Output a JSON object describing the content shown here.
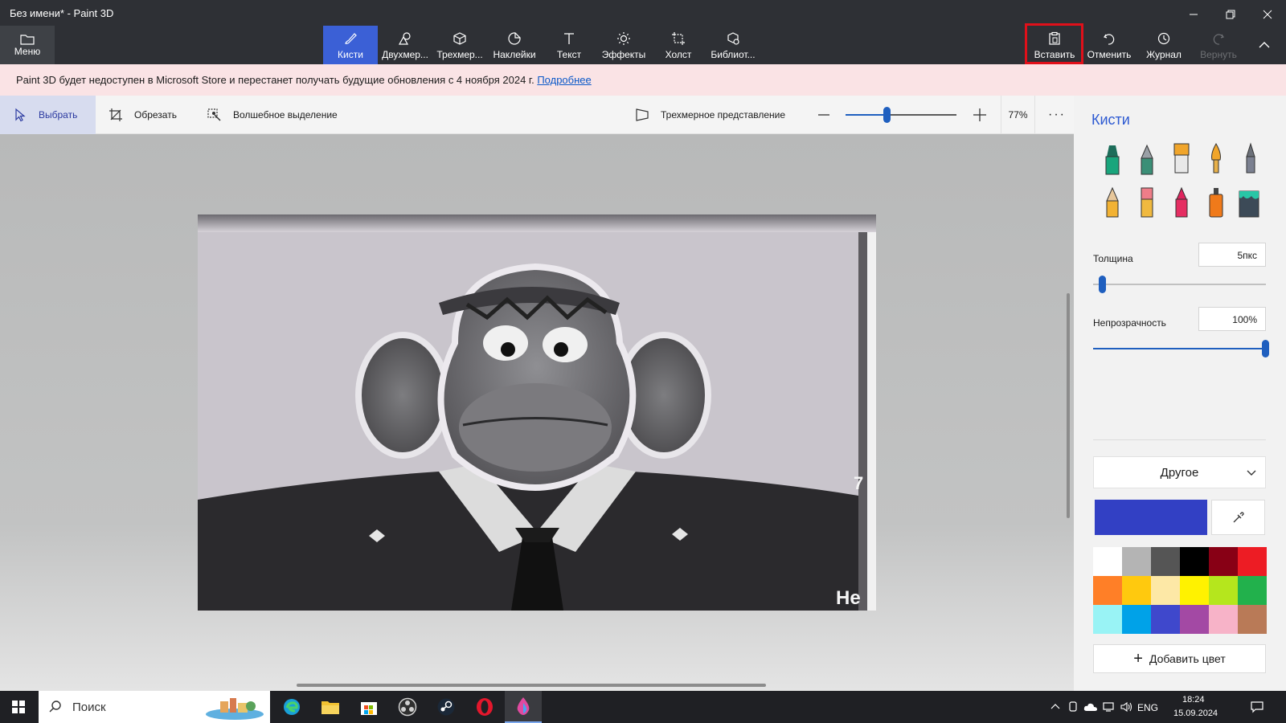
{
  "window": {
    "title": "Без имени* - Paint 3D"
  },
  "ribbon": {
    "menu_label": "Меню",
    "tools": [
      {
        "label": "Кисти",
        "icon": "brush-icon"
      },
      {
        "label": "Двухмер...",
        "icon": "2d-shapes-icon"
      },
      {
        "label": "Трехмер...",
        "icon": "3d-shapes-icon"
      },
      {
        "label": "Наклейки",
        "icon": "stickers-icon"
      },
      {
        "label": "Текст",
        "icon": "text-icon"
      },
      {
        "label": "Эффекты",
        "icon": "effects-icon"
      },
      {
        "label": "Холст",
        "icon": "canvas-icon"
      },
      {
        "label": "Библиот...",
        "icon": "library-icon"
      }
    ],
    "paste_label": "Вставить",
    "undo_label": "Отменить",
    "history_label": "Журнал",
    "redo_label": "Вернуть",
    "active_tool_color": "#3b60d6",
    "highlight_color": "#e0101a"
  },
  "notice": {
    "text": "Paint 3D будет недоступен в Microsoft Store и перестанет получать будущие обновления с 4 ноября 2024 г.",
    "link": "Подробнее"
  },
  "subtoolbar": {
    "select_label": "Выбрать",
    "crop_label": "Обрезать",
    "magic_select_label": "Волшебное выделение",
    "view3d_label": "Трехмерное представление",
    "zoom_value": "77%",
    "zoom_level": 0.38
  },
  "canvas": {
    "caption_number": "7",
    "caption_text": "Не"
  },
  "panel": {
    "title": "Кисти",
    "brushes": [
      "marker-icon",
      "calligraphy-pen-icon",
      "oil-brush-icon",
      "watercolor-icon",
      "pixel-pen-icon",
      "pencil-icon",
      "eraser-icon",
      "crayon-icon",
      "spray-can-icon",
      "fill-icon"
    ],
    "thickness_label": "Толщина",
    "thickness_value": "5пкс",
    "thickness_level": 0.05,
    "opacity_label": "Непрозрачность",
    "opacity_value": "100%",
    "opacity_level": 1.0,
    "color_mode": "Другое",
    "current_color": "#3240c4",
    "palette": [
      "#ffffff",
      "#b4b4b4",
      "#555555",
      "#000000",
      "#880015",
      "#ed1c24",
      "#ff7f27",
      "#ffc90e",
      "#fde8a6",
      "#fff200",
      "#b5e61d",
      "#22b14c",
      "#99f3f5",
      "#00a2e8",
      "#3f48cc",
      "#a349a4",
      "#f7b3c8",
      "#b97a57"
    ],
    "add_color_label": "Добавить цвет"
  },
  "taskbar": {
    "search_placeholder": "Поиск",
    "apps": [
      "edge-icon",
      "file-explorer-icon",
      "store-icon",
      "obs-icon",
      "steam-icon",
      "opera-icon",
      "paint3d-icon"
    ],
    "language": "ENG",
    "time": "18:24",
    "date": "15.09.2024"
  }
}
